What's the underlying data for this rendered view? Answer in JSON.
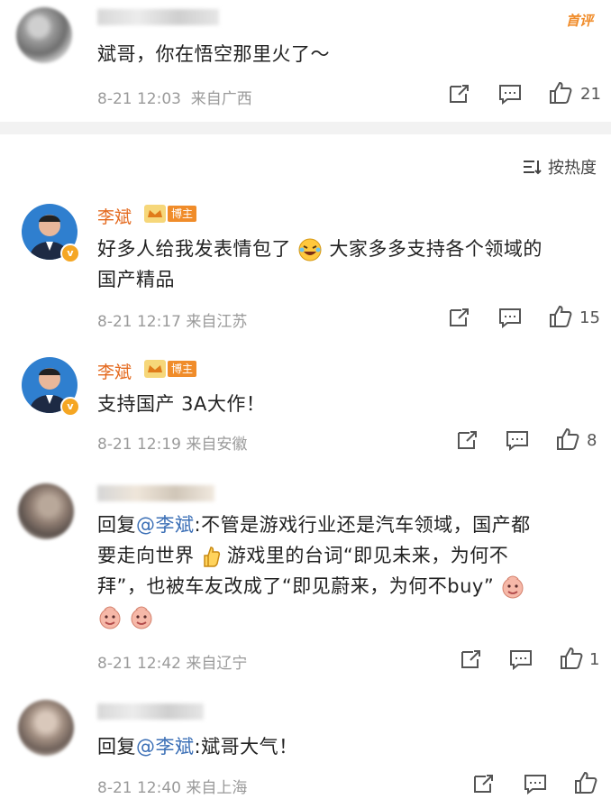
{
  "comments": [
    {
      "name": "",
      "text": "斌哥，你在悟空那里火了～",
      "date": "8-21 12:03",
      "location": "来自广西",
      "likes": "21",
      "tag": "首评"
    },
    {
      "name": "李斌",
      "badge": "博主",
      "text_a": "好多人给我发表情包了",
      "text_b": "大家多多支持各个领域的",
      "text_c": "国产精品",
      "date": "8-21 12:17",
      "location": "来自江苏",
      "likes": "15"
    },
    {
      "name": "李斌",
      "badge": "博主",
      "text": "支持国产 3A大作！",
      "date": "8-21 12:19",
      "location": "来自安徽",
      "likes": "8"
    },
    {
      "reply_prefix": "回复",
      "mention": "@李斌",
      "text_a": ":不管是游戏行业还是汽车领域，国产都",
      "text_b": "要走向世界",
      "text_c": "游戏里的台词“即见未来，为何不",
      "text_d": "拜”，也被车友改成了“即见蔚来，为何不buy”",
      "date": "8-21 12:42",
      "location": "来自辽宁",
      "likes": "1"
    },
    {
      "reply_prefix": "回复",
      "mention": "@李斌",
      "text": ":斌哥大气！",
      "date": "8-21 12:40",
      "location": "来自上海",
      "likes": ""
    }
  ],
  "sort_label": "按热度",
  "colors": {
    "name": "#e46a1f",
    "mention": "#3b6fb6",
    "badge": "#f08c2a",
    "meta": "#9a9a9a"
  }
}
